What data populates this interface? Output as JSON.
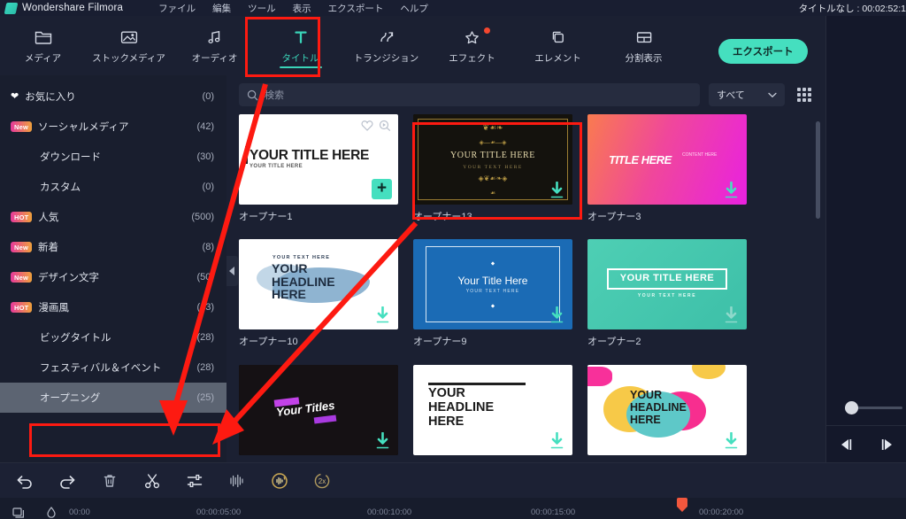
{
  "menubar": {
    "brand": "Wondershare Filmora",
    "items": [
      "ファイル",
      "編集",
      "ツール",
      "表示",
      "エクスポート",
      "ヘルプ"
    ],
    "project_title": "タイトルなし : 00:02:52:1"
  },
  "toolbar": {
    "tabs": [
      {
        "label": "メディア",
        "icon": "folder-icon",
        "active": false
      },
      {
        "label": "ストックメディア",
        "icon": "stock-media-icon",
        "active": false
      },
      {
        "label": "オーディオ",
        "icon": "audio-note-icon",
        "active": false
      },
      {
        "label": "タイトル",
        "icon": "text-t-icon",
        "active": true
      },
      {
        "label": "トランジション",
        "icon": "transition-icon",
        "active": false
      },
      {
        "label": "エフェクト",
        "icon": "effect-icon",
        "active": false
      },
      {
        "label": "エレメント",
        "icon": "element-icon",
        "active": false
      },
      {
        "label": "分割表示",
        "icon": "split-view-icon",
        "active": false
      }
    ],
    "export_label": "エクスポート",
    "accent_color": "#3ad4b8"
  },
  "sidebar": {
    "items": [
      {
        "label": "お気に入り",
        "count": "(0)",
        "badge": "",
        "icon": "heart-icon",
        "selected": false
      },
      {
        "label": "ソーシャルメディア",
        "count": "(42)",
        "badge": "New",
        "icon": "",
        "selected": false
      },
      {
        "label": "ダウンロード",
        "count": "(30)",
        "badge": "",
        "icon": "",
        "selected": false
      },
      {
        "label": "カスタム",
        "count": "(0)",
        "badge": "",
        "icon": "",
        "selected": false
      },
      {
        "label": "人気",
        "count": "(500)",
        "badge": "HOT",
        "icon": "",
        "selected": false
      },
      {
        "label": "新着",
        "count": "(8)",
        "badge": "New",
        "icon": "",
        "selected": false
      },
      {
        "label": "デザイン文字",
        "count": "(50)",
        "badge": "New",
        "icon": "",
        "selected": false
      },
      {
        "label": "漫画風",
        "count": "(43)",
        "badge": "HOT",
        "icon": "",
        "selected": false
      },
      {
        "label": "ビッグタイトル",
        "count": "(28)",
        "badge": "",
        "icon": "",
        "selected": false
      },
      {
        "label": "フェスティバル＆イベント",
        "count": "(28)",
        "badge": "",
        "icon": "",
        "selected": false
      },
      {
        "label": "オープニング",
        "count": "(25)",
        "badge": "",
        "icon": "",
        "selected": true
      }
    ]
  },
  "search": {
    "placeholder": "検索",
    "filter_label": "すべて"
  },
  "grid": {
    "items": [
      {
        "caption": "オープナー1",
        "style": "white-title",
        "title": "YOUR TITLE HERE",
        "subtitle": "YOUR TITLE HERE",
        "action": "plus"
      },
      {
        "caption": "オープナー13",
        "style": "gold-ornate",
        "title": "YOUR TITLE HERE",
        "subtitle": "YOUR TEXT HERE",
        "action": "download"
      },
      {
        "caption": "オープナー3",
        "style": "pink-gradient",
        "title": "TITLE HERE",
        "subtitle": "CONTENT HERE",
        "action": "download"
      },
      {
        "caption": "オープナー10",
        "style": "brush-stroke",
        "title": "YOUR HEADLINE HERE",
        "subtitle": "YOUR TEXT HERE",
        "action": "download"
      },
      {
        "caption": "オープナー9",
        "style": "blue-frame",
        "title": "Your Title Here",
        "subtitle": "YOUR TEXT HERE",
        "action": "download"
      },
      {
        "caption": "オープナー2",
        "style": "teal-frame",
        "title": "YOUR TITLE HERE",
        "subtitle": "YOUR TEXT HERE",
        "action": "download"
      },
      {
        "caption": "",
        "style": "dark-titles",
        "title": "Your Titles",
        "subtitle": "",
        "action": "download"
      },
      {
        "caption": "",
        "style": "headline-rule",
        "title": "YOUR HEADLINE HERE",
        "subtitle": "",
        "action": "download"
      },
      {
        "caption": "",
        "style": "color-shapes",
        "title": "YOUR HEADLINE HERE",
        "subtitle": "",
        "action": "download"
      }
    ]
  },
  "timeline": {
    "ticks": [
      "00:00",
      "00:00:05:00",
      "00:00:10:00",
      "00:00:15:00",
      "00:00:20:00"
    ],
    "playhead_color": "#f2573d"
  },
  "bottom_tools": [
    {
      "name": "undo-icon"
    },
    {
      "name": "redo-icon"
    },
    {
      "name": "delete-icon"
    },
    {
      "name": "split-scissors-icon"
    },
    {
      "name": "adjust-sliders-icon"
    },
    {
      "name": "audio-waveform-icon"
    },
    {
      "name": "audio-ducking-icon"
    },
    {
      "name": "speed-icon"
    }
  ],
  "annotations": {
    "color": "#fd1a11",
    "boxes": [
      "title-tab",
      "opener13-thumbnail",
      "opening-sidebar-item"
    ],
    "arrows": [
      "title-tab-to-opening",
      "opener13-to-opening"
    ]
  }
}
